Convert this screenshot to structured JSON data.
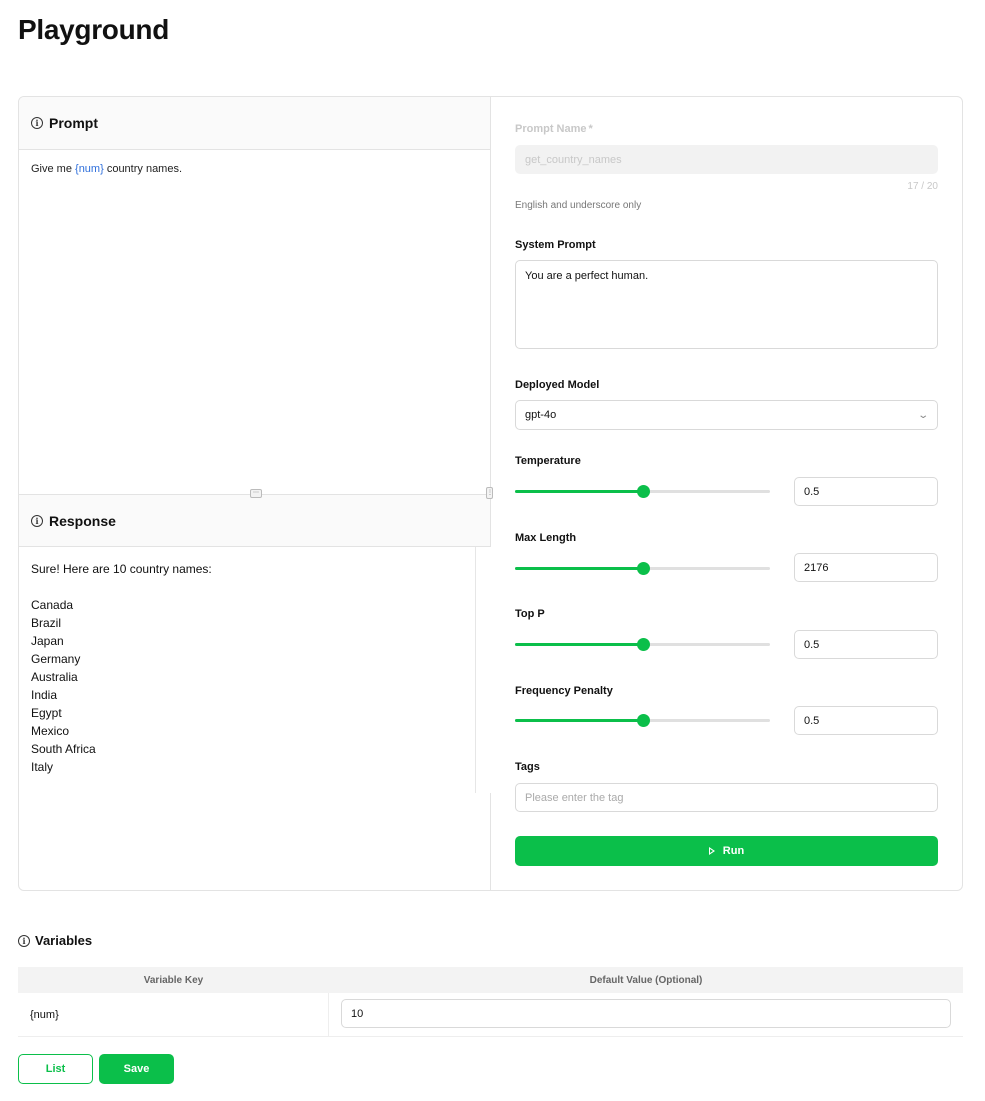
{
  "page": {
    "title": "Playground"
  },
  "prompt": {
    "header": "Prompt",
    "text_before": "Give me ",
    "variable": "{num}",
    "text_after": " country names."
  },
  "response": {
    "header": "Response",
    "lines": [
      "Sure! Here are 10 country names:",
      "",
      "Canada",
      "Brazil",
      "Japan",
      "Germany",
      "Australia",
      "India",
      "Egypt",
      "Mexico",
      "South Africa",
      "Italy"
    ]
  },
  "form": {
    "prompt_name": {
      "label": "Prompt Name",
      "required_mark": "*",
      "value": "get_country_names",
      "counter": "17  /  20",
      "hint": "English and underscore only"
    },
    "system_prompt": {
      "label": "System Prompt",
      "value": "You are a perfect human."
    },
    "deployed_model": {
      "label": "Deployed Model",
      "value": "gpt-4o"
    },
    "temperature": {
      "label": "Temperature",
      "value": "0.5",
      "fraction": 0.5
    },
    "max_length": {
      "label": "Max Length",
      "value": "2176",
      "fraction": 0.5
    },
    "top_p": {
      "label": "Top P",
      "value": "0.5",
      "fraction": 0.5
    },
    "frequency_penalty": {
      "label": "Frequency Penalty",
      "value": "0.5",
      "fraction": 0.5
    },
    "tags": {
      "label": "Tags",
      "placeholder": "Please enter the tag"
    },
    "run_label": "Run"
  },
  "variables": {
    "title": "Variables",
    "columns": [
      "Variable Key",
      "Default Value (Optional)"
    ],
    "rows": [
      {
        "key": "{num}",
        "value": "10"
      }
    ]
  },
  "actions": {
    "list_label": "List",
    "save_label": "Save"
  },
  "colors": {
    "accent": "#0bbf4a",
    "variable_highlight": "#2f6fdb"
  }
}
